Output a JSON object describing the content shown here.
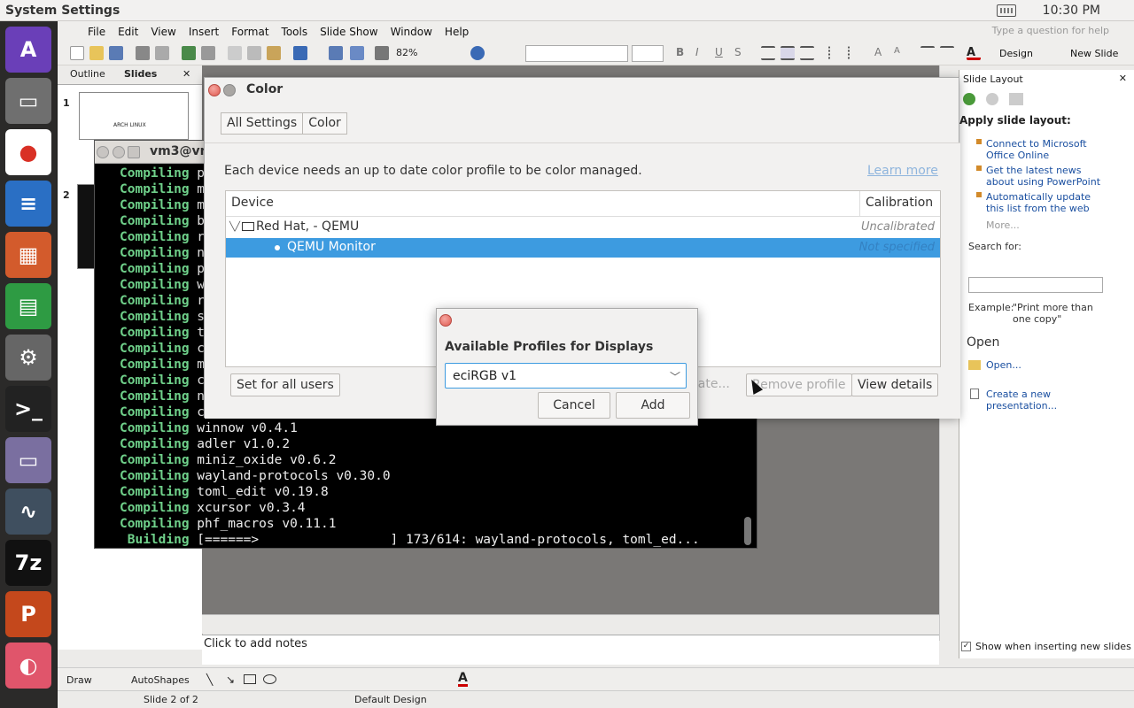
{
  "top_panel": {
    "title": "System Settings",
    "clock": "10:30 PM"
  },
  "launcher": {
    "items": [
      {
        "name": "launcher-logo",
        "color": "#6a3fb8",
        "glyph": "A"
      },
      {
        "name": "files-drive",
        "color": "#6f6f6f",
        "glyph": "▭"
      },
      {
        "name": "chrome",
        "color": "#ffffff",
        "glyph": "●"
      },
      {
        "name": "writer",
        "color": "#2a6fc4",
        "glyph": "≡"
      },
      {
        "name": "impress",
        "color": "#d35b2c",
        "glyph": "▦"
      },
      {
        "name": "calc",
        "color": "#2e9b43",
        "glyph": "▤"
      },
      {
        "name": "settings",
        "color": "#666666",
        "glyph": "⚙"
      },
      {
        "name": "terminal",
        "color": "#222222",
        "glyph": ">_"
      },
      {
        "name": "folder",
        "color": "#7a6fa0",
        "glyph": "▭"
      },
      {
        "name": "system-monitor",
        "color": "#3f4f5f",
        "glyph": "∿"
      },
      {
        "name": "7zip",
        "color": "#111111",
        "glyph": "7z"
      },
      {
        "name": "powerpoint",
        "color": "#c4481c",
        "glyph": "P"
      },
      {
        "name": "color-wheel",
        "color": "#e0556b",
        "glyph": "◐"
      }
    ]
  },
  "impress": {
    "menus": [
      "File",
      "Edit",
      "View",
      "Insert",
      "Format",
      "Tools",
      "Slide Show",
      "Window",
      "Help"
    ],
    "help_placeholder": "Type a question for help",
    "zoom": "82%",
    "design_label": "Design",
    "new_slide_label": "New Slide",
    "pane_tabs": [
      "Outline",
      "Slides"
    ],
    "slide_thumb_text": "ARCH LINUX",
    "slide_numbers": [
      "1",
      "2"
    ],
    "notes_placeholder": "Click to add notes",
    "right_pane": {
      "title": "Slide Layout",
      "apply_label": "Apply slide layout:",
      "links": [
        "Connect to Microsoft Office Online",
        "Get the latest news about using PowerPoint",
        "Automatically update this list from the web"
      ],
      "more": "More...",
      "search_label": "Search for:",
      "example_label": "Example:",
      "example_text": "\"Print more than one copy\"",
      "open_heading": "Open",
      "open_link": "Open...",
      "create_link": "Create a new presentation...",
      "show_inserting": "Show when inserting new slides"
    },
    "draw_label": "Draw",
    "autoshapes_label": "AutoShapes",
    "status": {
      "slide": "Slide 2 of 2",
      "design": "Default Design"
    }
  },
  "terminal": {
    "title": "vm3@vm",
    "lines": [
      {
        "kw": "Compiling",
        "text": " p"
      },
      {
        "kw": "Compiling",
        "text": " m"
      },
      {
        "kw": "Compiling",
        "text": " m"
      },
      {
        "kw": "Compiling",
        "text": " b"
      },
      {
        "kw": "Compiling",
        "text": " r"
      },
      {
        "kw": "Compiling",
        "text": " n"
      },
      {
        "kw": "Compiling",
        "text": " p"
      },
      {
        "kw": "Compiling",
        "text": " w"
      },
      {
        "kw": "Compiling",
        "text": " r"
      },
      {
        "kw": "Compiling",
        "text": " s"
      },
      {
        "kw": "Compiling",
        "text": " t"
      },
      {
        "kw": "Compiling",
        "text": " c"
      },
      {
        "kw": "Compiling",
        "text": " m"
      },
      {
        "kw": "Compiling",
        "text": " c"
      },
      {
        "kw": "Compiling",
        "text": " n"
      },
      {
        "kw": "Compiling",
        "text": " c"
      },
      {
        "kw": "Compiling",
        "text": " winnow v0.4.1"
      },
      {
        "kw": "Compiling",
        "text": " adler v1.0.2"
      },
      {
        "kw": "Compiling",
        "text": " miniz_oxide v0.6.2"
      },
      {
        "kw": "Compiling",
        "text": " wayland-protocols v0.30.0"
      },
      {
        "kw": "Compiling",
        "text": " toml_edit v0.19.8"
      },
      {
        "kw": "Compiling",
        "text": " xcursor v0.3.4"
      },
      {
        "kw": "Compiling",
        "text": " phf_macros v0.11.1"
      },
      {
        "kw": " Building",
        "text": " [======>                 ] 173/614: wayland-protocols, toml_ed..."
      }
    ]
  },
  "color_window": {
    "title": "Color",
    "tabs": [
      "All Settings",
      "Color"
    ],
    "description": "Each device needs an up to date color profile to be color managed.",
    "learn_more": "Learn more",
    "columns": {
      "device": "Device",
      "calibration": "Calibration"
    },
    "rows": [
      {
        "name": "Red Hat, - QEMU",
        "calibration": "Uncalibrated"
      },
      {
        "name": "QEMU Monitor",
        "calibration": "Not specified"
      }
    ],
    "buttons": {
      "set_for_all": "Set for all users",
      "calibrate": "rate...",
      "remove": "Remove profile",
      "view": "View details"
    }
  },
  "dialog": {
    "heading": "Available Profiles for Displays",
    "selected_profile": "eciRGB v1",
    "cancel": "Cancel",
    "add": "Add"
  },
  "colors": {
    "selection": "#3d9be0",
    "term_keyword": "#6fd08a"
  }
}
